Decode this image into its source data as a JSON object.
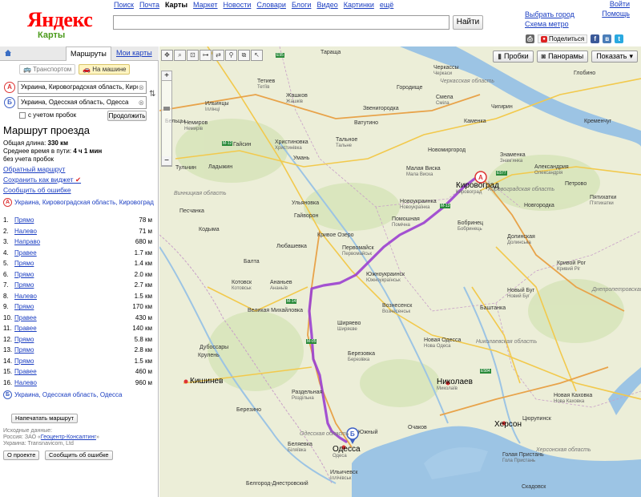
{
  "header": {
    "logo": "Яндекс",
    "logo_sub": "Карты",
    "services": [
      "Поиск",
      "Почта",
      "Карты",
      "Маркет",
      "Новости",
      "Словари",
      "Блоги",
      "Видео",
      "Картинки",
      "ещё"
    ],
    "active_service": "Карты",
    "search_button": "Найти",
    "select_city": "Выбрать город",
    "metro_map": "Схема метро",
    "login": "Войти",
    "help": "Помощь",
    "share": "Поделиться"
  },
  "panel": {
    "tab_routes": "Маршруты",
    "tab_mymaps": "Мои карты",
    "mode_transport": "Транспортом",
    "mode_car": "На машине",
    "point_a": "Украина, Кировоградская область, Киров",
    "point_b": "Украина, Одесская область, Одесса",
    "traffic_label": "с учетом пробок",
    "extend_button": "Продолжить",
    "route_title": "Маршрут проезда",
    "total_label": "Общая длина:",
    "total_value": "330 км",
    "time_label": "Среднее время в пути:",
    "time_value": "4 ч 1 мин",
    "no_traffic": "без учета пробок",
    "reverse_link": "Обратный маршрут",
    "widget_link": "Сохранить как виджет",
    "error_link": "Сообщить об ошибке",
    "start_label": "Украина, Кировоградская область, Кировоград",
    "end_label": "Украина, Одесская область, Одесса",
    "steps": [
      {
        "n": "1.",
        "action": "Прямо",
        "dist": "78 м"
      },
      {
        "n": "2.",
        "action": "Налево",
        "dist": "71 м"
      },
      {
        "n": "3.",
        "action": "Направо",
        "dist": "680 м"
      },
      {
        "n": "4.",
        "action": "Правее",
        "dist": "1.7 км"
      },
      {
        "n": "5.",
        "action": "Прямо",
        "dist": "1.4 км"
      },
      {
        "n": "6.",
        "action": "Прямо",
        "dist": "2.0 км"
      },
      {
        "n": "7.",
        "action": "Прямо",
        "dist": "2.7 км"
      },
      {
        "n": "8.",
        "action": "Налево",
        "dist": "1.5 км"
      },
      {
        "n": "9.",
        "action": "Прямо",
        "dist": "170 км"
      },
      {
        "n": "10.",
        "action": "Правее",
        "dist": "430 м"
      },
      {
        "n": "11.",
        "action": "Правее",
        "dist": "140 км"
      },
      {
        "n": "12.",
        "action": "Прямо",
        "dist": "5.8 км"
      },
      {
        "n": "13.",
        "action": "Прямо",
        "dist": "2.8 км"
      },
      {
        "n": "14.",
        "action": "Прямо",
        "dist": "1.5 км"
      },
      {
        "n": "15.",
        "action": "Правее",
        "dist": "460 м"
      },
      {
        "n": "16.",
        "action": "Налево",
        "dist": "960 м"
      }
    ],
    "print_button": "Напечатать маршрут",
    "source_line1": "Исходные данные:",
    "source_line2_prefix": "Россия: ЗАО «",
    "source_line2_link": "Геоцентр-Консалтинг",
    "source_line2_suffix": "»",
    "source_line3": "Украина: Transnavicom, Ltd",
    "about_button": "О проекте",
    "report_button": "Сообщить об ошибке"
  },
  "map": {
    "traffic_btn": "Пробки",
    "panoramas_btn": "Панорамы",
    "show_btn": "Показать",
    "route_color": "#9b3fd0",
    "cities": [
      {
        "name": "Кировоград",
        "sub": "Кировоград",
        "big": true
      },
      {
        "name": "Одесса",
        "sub": "Одеса",
        "big": true
      },
      {
        "name": "Николаев",
        "sub": "Миколаїв",
        "big": true
      },
      {
        "name": "Херсон",
        "sub": "",
        "big": true
      },
      {
        "name": "Кишинев",
        "sub": "",
        "big": true
      },
      {
        "name": "Черкассы",
        "sub": "Черкаси",
        "big": false
      },
      {
        "name": "Умань",
        "sub": "",
        "big": false
      },
      {
        "name": "Первомайск",
        "sub": "Первомайськ",
        "big": false
      },
      {
        "name": "Вознесенск",
        "sub": "Вознесенськ",
        "big": false
      },
      {
        "name": "Кривой Рог",
        "sub": "Кривий Ріг",
        "big": false
      },
      {
        "name": "Тульчин",
        "sub": "",
        "big": false
      },
      {
        "name": "Балта",
        "sub": "",
        "big": false
      },
      {
        "name": "Котовск",
        "sub": "Котовськ",
        "big": false
      },
      {
        "name": "Ананьев",
        "sub": "Ананьїв",
        "big": false
      },
      {
        "name": "Новоукраинка",
        "sub": "Новоукраїнка",
        "big": false
      },
      {
        "name": "Бобринец",
        "sub": "Бобринець",
        "big": false
      },
      {
        "name": "Александрия",
        "sub": "Олександрія",
        "big": false
      },
      {
        "name": "Знаменка",
        "sub": "Знам'янка",
        "big": false
      },
      {
        "name": "Смела",
        "sub": "Сміла",
        "big": false
      },
      {
        "name": "Тальное",
        "sub": "Тальне",
        "big": false
      },
      {
        "name": "Ватутино",
        "sub": "",
        "big": false
      },
      {
        "name": "Малая Виска",
        "sub": "Мала Виска",
        "big": false
      },
      {
        "name": "Новомиргород",
        "sub": "",
        "big": false
      },
      {
        "name": "Гайворон",
        "sub": "",
        "big": false
      },
      {
        "name": "Ульяновка",
        "sub": "",
        "big": false
      },
      {
        "name": "Помошная",
        "sub": "Помічна",
        "big": false
      },
      {
        "name": "Южноукраинск",
        "sub": "Южноукраїнськ",
        "big": false
      },
      {
        "name": "Березовка",
        "sub": "Березівка",
        "big": false
      },
      {
        "name": "Раздельная",
        "sub": "Роздільна",
        "big": false
      },
      {
        "name": "Беляевка",
        "sub": "Біляївка",
        "big": false
      },
      {
        "name": "Ильичевск",
        "sub": "Іллічівськ",
        "big": false
      },
      {
        "name": "Белгород-Днестровский",
        "sub": "",
        "big": false
      },
      {
        "name": "Очаков",
        "sub": "",
        "big": false
      },
      {
        "name": "Новая Одесса",
        "sub": "Нова Одеса",
        "big": false
      },
      {
        "name": "Баштанка",
        "sub": "",
        "big": false
      },
      {
        "name": "Новый Буг",
        "sub": "Новий Буг",
        "big": false
      },
      {
        "name": "Новая Каховка",
        "sub": "Нова Каховка",
        "big": false
      },
      {
        "name": "Цюрупинск",
        "sub": "",
        "big": false
      },
      {
        "name": "Голая Пристань",
        "sub": "Гола Пристань",
        "big": false
      },
      {
        "name": "Скадовск",
        "sub": "",
        "big": false
      },
      {
        "name": "Южный",
        "sub": "",
        "big": false
      },
      {
        "name": "Дубоссары",
        "sub": "",
        "big": false
      },
      {
        "name": "Крулень",
        "sub": "",
        "big": false
      },
      {
        "name": "Бельцы",
        "sub": "",
        "big": false
      },
      {
        "name": "Долинская",
        "sub": "Долинська",
        "big": false
      },
      {
        "name": "Петрово",
        "sub": "",
        "big": false
      },
      {
        "name": "Пятихатки",
        "sub": "П'ятихатки",
        "big": false
      },
      {
        "name": "Новгородка",
        "sub": "",
        "big": false
      },
      {
        "name": "Кременчуг",
        "sub": "",
        "big": false
      },
      {
        "name": "Глобино",
        "sub": "",
        "big": false
      },
      {
        "name": "Чигирин",
        "sub": "",
        "big": false
      },
      {
        "name": "Каменка",
        "sub": "",
        "big": false
      },
      {
        "name": "Городище",
        "sub": "",
        "big": false
      },
      {
        "name": "Звенигородка",
        "sub": "",
        "big": false
      },
      {
        "name": "Христиновка",
        "sub": "Христинівка",
        "big": false
      },
      {
        "name": "Гайсин",
        "sub": "",
        "big": false
      },
      {
        "name": "Тетиев",
        "sub": "Тетіїв",
        "big": false
      },
      {
        "name": "Жашков",
        "sub": "Жашків",
        "big": false
      },
      {
        "name": "Тараща",
        "sub": "",
        "big": false
      },
      {
        "name": "Ильинцы",
        "sub": "Іллінці",
        "big": false
      },
      {
        "name": "Немиров",
        "sub": "Немирів",
        "big": false
      },
      {
        "name": "Ладыжин",
        "sub": "",
        "big": false
      },
      {
        "name": "Песчанка",
        "sub": "",
        "big": false
      },
      {
        "name": "Кодыма",
        "sub": "",
        "big": false
      },
      {
        "name": "Любашевка",
        "sub": "",
        "big": false
      },
      {
        "name": "Кривое Озеро",
        "sub": "",
        "big": false
      },
      {
        "name": "Великая Михайловка",
        "sub": "",
        "big": false
      },
      {
        "name": "Ширяево",
        "sub": "Ширяєве",
        "big": false
      },
      {
        "name": "Березино",
        "sub": "",
        "big": false
      }
    ],
    "regions": [
      "Черкасская область",
      "Кировоградская область",
      "Одесская область",
      "Николаевская область",
      "Херсонская область",
      "Днепропетровская область",
      "Винницкая область"
    ],
    "roads": [
      "E95",
      "M-12",
      "E577",
      "M-13",
      "M-05",
      "E584",
      "M-14"
    ]
  }
}
